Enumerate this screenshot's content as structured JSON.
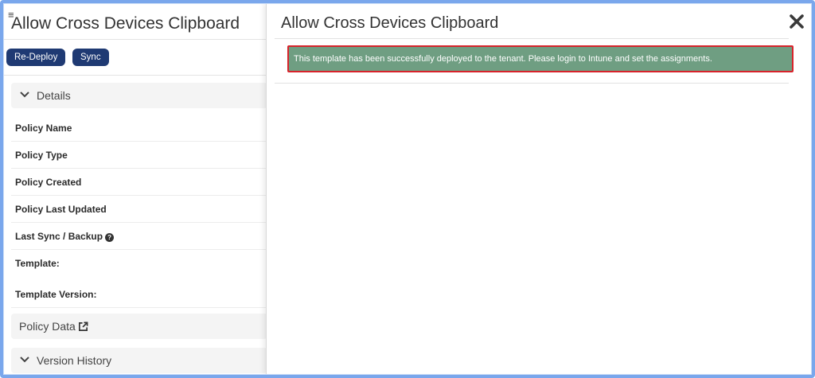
{
  "left_panel": {
    "menu_icon": "hamburger-icon",
    "title": "Allow Cross Devices Clipboard",
    "buttons": {
      "redeploy": "Re-Deploy",
      "sync": "Sync"
    },
    "details_section": {
      "label": "Details",
      "icon": "chevron-down-icon"
    },
    "fields": [
      {
        "label": "Policy Name"
      },
      {
        "label": "Policy Type"
      },
      {
        "label": "Policy Created"
      },
      {
        "label": "Policy Last Updated"
      },
      {
        "label": "Last Sync / Backup",
        "icon": "question-circle-icon"
      },
      {
        "label": "Template:"
      },
      {
        "label": "Template Version:"
      }
    ],
    "policy_data_section": {
      "label": "Policy Data",
      "icon": "external-link-icon"
    },
    "version_history_section": {
      "label": "Version History",
      "icon": "chevron-down-icon"
    }
  },
  "modal": {
    "title": "Allow Cross Devices Clipboard",
    "close_icon": "close-icon",
    "alert_message": "This template has been successfully deployed to the tenant. Please login to Intune and set the assignments."
  },
  "colors": {
    "primary_button": "#1f3a73",
    "alert_background": "#6f9e82",
    "alert_highlight_border": "#d7232b",
    "frame_border": "#7aa7ec"
  }
}
